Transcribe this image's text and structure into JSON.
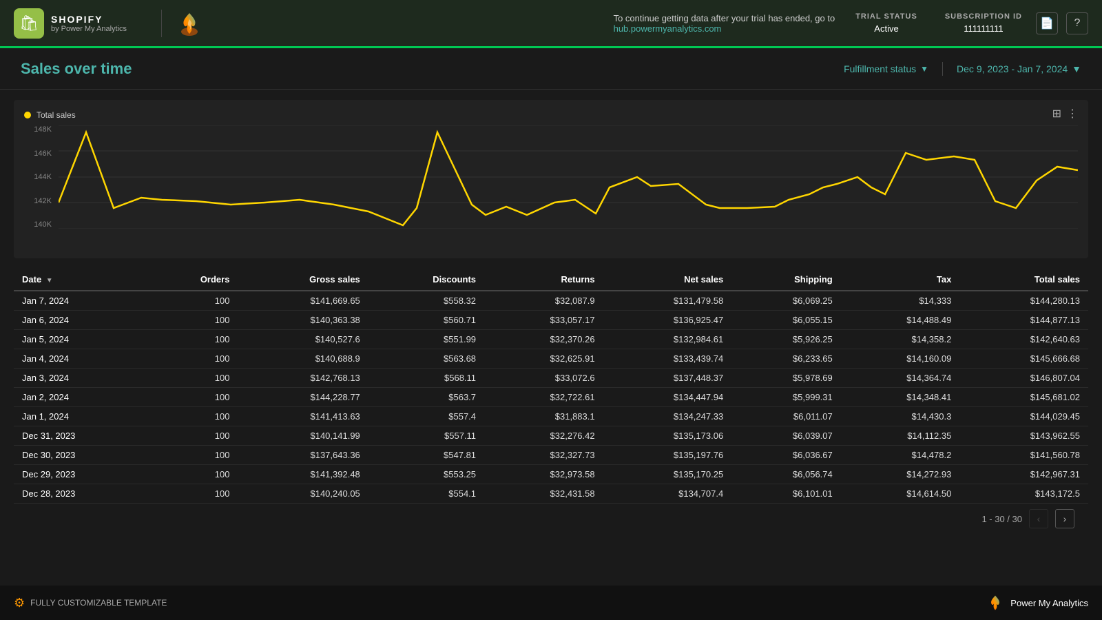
{
  "header": {
    "shopify_label": "SHOPIFY",
    "shopify_sublabel": "by Power My Analytics",
    "trial_notice": "To continue getting data after your trial has ended, go to",
    "trial_link": "hub.powermyanalytics.com",
    "trial_status_label": "TRIAL STATUS",
    "trial_status_value": "Active",
    "subscription_id_label": "SUBSCRIPTION ID",
    "subscription_id_value": "111111111"
  },
  "page": {
    "title": "Sales over time",
    "fulfillment_label": "Fulfillment status",
    "date_range": "Dec 9, 2023 - Jan 7, 2024"
  },
  "chart": {
    "legend_label": "Total sales",
    "y_labels": [
      "148K",
      "146K",
      "144K",
      "142K",
      "140K"
    ]
  },
  "table": {
    "columns": [
      "Date",
      "Orders",
      "Gross sales",
      "Discounts",
      "Returns",
      "Net sales",
      "Shipping",
      "Tax",
      "Total sales"
    ],
    "rows": [
      [
        "Jan 7, 2024",
        "100",
        "$141,669.65",
        "$558.32",
        "$32,087.9",
        "$131,479.58",
        "$6,069.25",
        "$14,333",
        "$144,280.13"
      ],
      [
        "Jan 6, 2024",
        "100",
        "$140,363.38",
        "$560.71",
        "$33,057.17",
        "$136,925.47",
        "$6,055.15",
        "$14,488.49",
        "$144,877.13"
      ],
      [
        "Jan 5, 2024",
        "100",
        "$140,527.6",
        "$551.99",
        "$32,370.26",
        "$132,984.61",
        "$5,926.25",
        "$14,358.2",
        "$142,640.63"
      ],
      [
        "Jan 4, 2024",
        "100",
        "$140,688.9",
        "$563.68",
        "$32,625.91",
        "$133,439.74",
        "$6,233.65",
        "$14,160.09",
        "$145,666.68"
      ],
      [
        "Jan 3, 2024",
        "100",
        "$142,768.13",
        "$568.11",
        "$33,072.6",
        "$137,448.37",
        "$5,978.69",
        "$14,364.74",
        "$146,807.04"
      ],
      [
        "Jan 2, 2024",
        "100",
        "$144,228.77",
        "$563.7",
        "$32,722.61",
        "$134,447.94",
        "$5,999.31",
        "$14,348.41",
        "$145,681.02"
      ],
      [
        "Jan 1, 2024",
        "100",
        "$141,413.63",
        "$557.4",
        "$31,883.1",
        "$134,247.33",
        "$6,011.07",
        "$14,430.3",
        "$144,029.45"
      ],
      [
        "Dec 31, 2023",
        "100",
        "$140,141.99",
        "$557.11",
        "$32,276.42",
        "$135,173.06",
        "$6,039.07",
        "$14,112.35",
        "$143,962.55"
      ],
      [
        "Dec 30, 2023",
        "100",
        "$137,643.36",
        "$547.81",
        "$32,327.73",
        "$135,197.76",
        "$6,036.67",
        "$14,478.2",
        "$141,560.78"
      ],
      [
        "Dec 29, 2023",
        "100",
        "$141,392.48",
        "$553.25",
        "$32,973.58",
        "$135,170.25",
        "$6,056.74",
        "$14,272.93",
        "$142,967.31"
      ],
      [
        "Dec 28, 2023",
        "100",
        "$140,240.05",
        "$554.1",
        "$32,431.58",
        "$134,707.4",
        "$6,101.01",
        "$14,614.50",
        "$143,172.5"
      ]
    ],
    "pagination": "1 - 30 / 30"
  },
  "footer": {
    "template_label": "FULLY CUSTOMIZABLE TEMPLATE",
    "brand_label": "Power My Analytics"
  }
}
